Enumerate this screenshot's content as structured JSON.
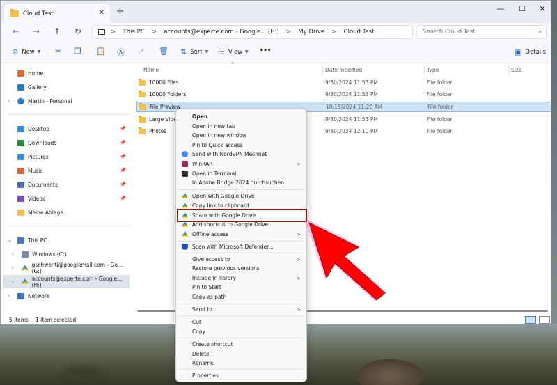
{
  "window": {
    "tab_title": "Cloud Test",
    "tab_close": "✕",
    "tab_add": "+",
    "controls": {
      "minimize": "—",
      "maximize": "☐",
      "close": "✕"
    }
  },
  "nav": {
    "back": "←",
    "forward": "→",
    "up": "↑",
    "refresh": "↻"
  },
  "address": {
    "crumbs": [
      "This PC",
      "accounts@experte.com - Google... (H:)",
      "My Drive",
      "Cloud Test"
    ],
    "separator": ">",
    "search_placeholder": "Search Cloud Test"
  },
  "toolbar": {
    "new_label": "New",
    "sort_label": "Sort",
    "view_label": "View",
    "more_label": "•••",
    "details_label": "Details"
  },
  "sidebar": {
    "quick": [
      {
        "label": "Home",
        "color": "#e46a2e"
      },
      {
        "label": "Gallery",
        "color": "#2b7fd0"
      },
      {
        "label": "Martin - Personal",
        "color": "#2b7fd0"
      }
    ],
    "pinned": [
      {
        "label": "Desktop",
        "color": "#3a8ed8"
      },
      {
        "label": "Downloads",
        "color": "#2f8a3f"
      },
      {
        "label": "Pictures",
        "color": "#3a8ed8"
      },
      {
        "label": "Music",
        "color": "#e0673b"
      },
      {
        "label": "Documents",
        "color": "#4f6fa8"
      },
      {
        "label": "Videos",
        "color": "#7b4fbf"
      },
      {
        "label": "Meine Ablage",
        "color": "#f3c14a"
      }
    ],
    "this_pc_label": "This PC",
    "drives": [
      "Windows (C:)",
      "gschwenti@googlemail.com - Go... (G:)",
      "accounts@experte.com - Google... (H:)"
    ],
    "network_label": "Network"
  },
  "columns": {
    "name": "Name",
    "date": "Date modified",
    "type": "Type",
    "size": "Size"
  },
  "files": [
    {
      "name": "10000 Files",
      "date": "9/30/2024 11:53 PM",
      "type": "File folder"
    },
    {
      "name": "10000 Folders",
      "date": "9/30/2024 11:53 PM",
      "type": "File folder"
    },
    {
      "name": "File Preview",
      "date": "10/15/2024 11:20 AM",
      "type": "File folder"
    },
    {
      "name": "Large Video",
      "date": "9/30/2024 11:53 PM",
      "type": "File folder"
    },
    {
      "name": "Photos",
      "date": "9/30/2024 12:10 PM",
      "type": "File folder"
    }
  ],
  "status": {
    "items": "5 items",
    "selected": "1 item selected"
  },
  "context_menu": {
    "open": "Open",
    "open_new_tab": "Open in new tab",
    "open_new_window": "Open in new window",
    "pin_quick": "Pin to Quick access",
    "nordvpn": "Send with NordVPN Meshnet",
    "winrar": "WinRAR",
    "terminal": "Open in Terminal",
    "bridge": "In Adobe Bridge 2024 durchsuchen",
    "open_gdrive": "Open with Google Drive",
    "copy_link": "Copy link to clipboard",
    "share_gdrive": "Share with Google Drive",
    "add_shortcut_gdrive": "Add shortcut to Google Drive",
    "offline": "Offline access",
    "defender": "Scan with Microsoft Defender...",
    "give_access": "Give access to",
    "restore": "Restore previous versions",
    "include_library": "Include in library",
    "pin_start": "Pin to Start",
    "copy_path": "Copy as path",
    "send_to": "Send to",
    "cut": "Cut",
    "copy": "Copy",
    "create_shortcut": "Create shortcut",
    "delete": "Delete",
    "rename": "Rename",
    "properties": "Properties",
    "submenu_arrow": ">"
  },
  "colors": {
    "arrow": "#ff0000",
    "highlight_outline": "#7a1f0f",
    "selection": "#cce3f6"
  }
}
